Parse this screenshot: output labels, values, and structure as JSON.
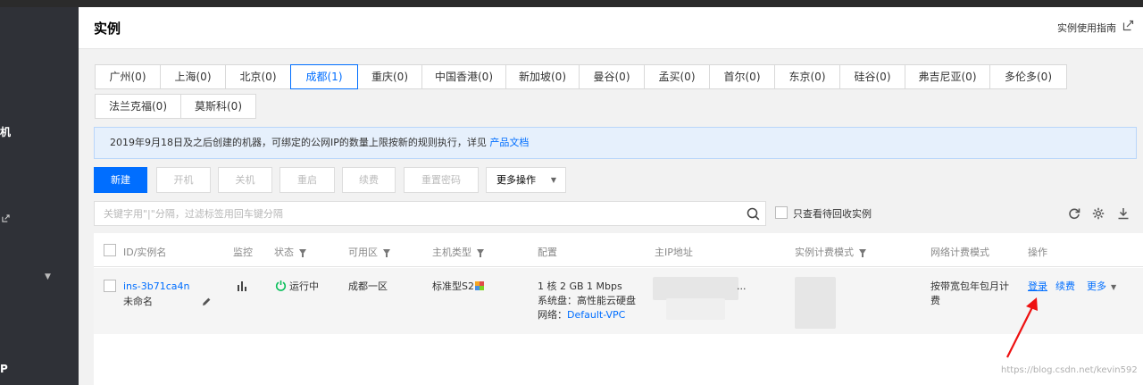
{
  "sidebar": {
    "fragment_1": "机",
    "fragment_2": "P"
  },
  "header": {
    "title": "实例",
    "guide_label": "实例使用指南"
  },
  "regions": {
    "row1": [
      "广州(0)",
      "上海(0)",
      "北京(0)",
      "成都(1)",
      "重庆(0)",
      "中国香港(0)",
      "新加坡(0)",
      "曼谷(0)",
      "孟买(0)",
      "首尔(0)",
      "东京(0)",
      "硅谷(0)",
      "弗吉尼亚(0)",
      "多伦多(0)"
    ],
    "row2": [
      "法兰克福(0)",
      "莫斯科(0)"
    ],
    "active": "成都(1)"
  },
  "notice": {
    "text": "2019年9月18日及之后创建的机器，可绑定的公网IP的数量上限按新的规则执行，详见 ",
    "link": "产品文档"
  },
  "toolbar": {
    "create": "新建",
    "start": "开机",
    "stop": "关机",
    "restart": "重启",
    "renew": "续费",
    "reset_password": "重置密码",
    "more_actions": "更多操作"
  },
  "search": {
    "placeholder": "关键字用\"|\"分隔，过滤标签用回车键分隔",
    "recycle_label": "只查看待回收实例"
  },
  "table": {
    "headers": {
      "id_name": "ID/实例名",
      "monitor": "监控",
      "status": "状态",
      "zone": "可用区",
      "type": "主机类型",
      "config": "配置",
      "ip": "主IP地址",
      "billing": "实例计费模式",
      "network_billing": "网络计费模式",
      "actions": "操作"
    },
    "rows": [
      {
        "id": "ins-3b71ca4n",
        "name": "未命名",
        "status": "运行中",
        "zone": "成都一区",
        "type": "标准型S2",
        "config_line1": "1 核 2 GB 1 Mbps",
        "config_line2": "系统盘：高性能云硬盘",
        "config_network_label": "网络：",
        "config_network": "Default-VPC",
        "ip_suffix": "...",
        "network_billing_line1": "按带宽包年包月计",
        "network_billing_line2": "费",
        "action_login": "登录",
        "action_renew": "续费",
        "action_more": "更多"
      }
    ]
  },
  "colors": {
    "accent": "#006eff",
    "running": "#0abf5b",
    "annotation_arrow": "#ee1111"
  },
  "watermark": "https://blog.csdn.net/kevin592"
}
